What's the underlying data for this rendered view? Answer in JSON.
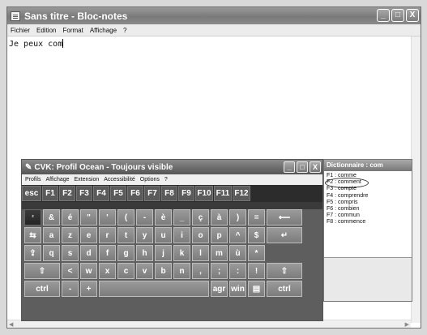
{
  "notepad": {
    "title": "Sans titre - Bloc-notes",
    "menu": [
      "Fichier",
      "Edition",
      "Format",
      "Affichage",
      "?"
    ],
    "content": "Je peux com",
    "controls": [
      "_",
      "□",
      "X"
    ]
  },
  "cvk": {
    "title": "CVK: Profil Ocean - Toujours visible",
    "menu": [
      "Profils",
      "Affichage",
      "Extension",
      "Accessibilité",
      "Options",
      "?"
    ],
    "fkeys": [
      "esc",
      "F1",
      "F2",
      "F3",
      "F4",
      "F5",
      "F6",
      "F7",
      "F8",
      "F9",
      "F10",
      "F11",
      "F12"
    ],
    "row1": [
      "²",
      "&",
      "é",
      "\"",
      "'",
      "(",
      "-",
      "è",
      "_",
      "ç",
      "à",
      ")",
      "=",
      "⟵"
    ],
    "row2": [
      "⇆",
      "a",
      "z",
      "e",
      "r",
      "t",
      "y",
      "u",
      "i",
      "o",
      "p",
      "^",
      "$",
      "↵"
    ],
    "row3": [
      "⇪",
      "q",
      "s",
      "d",
      "f",
      "g",
      "h",
      "j",
      "k",
      "l",
      "m",
      "ù",
      "*"
    ],
    "row4": [
      "⇧",
      "<",
      "w",
      "x",
      "c",
      "v",
      "b",
      "n",
      ",",
      ";",
      ":",
      "!",
      "⇧"
    ],
    "row5": [
      "ctrl",
      "-",
      "+",
      "",
      "agr",
      "win",
      "▤",
      "ctrl"
    ]
  },
  "dictionary": {
    "title": "Dictionnaire : com",
    "items": [
      "F1 : comme",
      "F2 : comment",
      "F3 : compte",
      "F4 : comprendre",
      "F5 : compris",
      "F6 : combien",
      "F7 : commun",
      "F8 : commence"
    ]
  }
}
